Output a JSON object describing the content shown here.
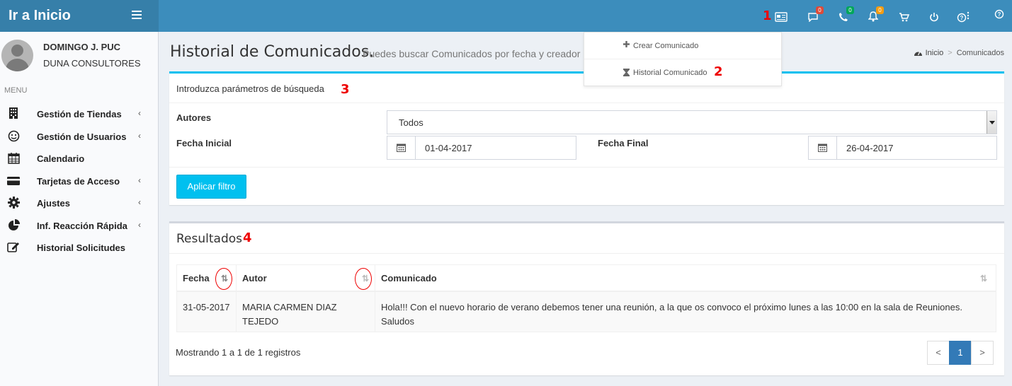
{
  "header": {
    "brand": "Ir a Inicio",
    "icons": [
      {
        "name": "newspaper-icon",
        "badge": ""
      },
      {
        "name": "chat-icon",
        "badge": "0",
        "badge_color": "#dd4b39"
      },
      {
        "name": "phone-icon",
        "badge": "0",
        "badge_color": "#00a65a"
      },
      {
        "name": "bell-icon",
        "badge": "0",
        "badge_color": "#f39c12"
      },
      {
        "name": "cart-icon",
        "badge": ""
      },
      {
        "name": "power-icon",
        "badge": ""
      },
      {
        "name": "help-icon",
        "badge": ""
      },
      {
        "name": "help-icon",
        "badge": ""
      }
    ]
  },
  "annotations": {
    "m1": "1",
    "m2": "2",
    "m3": "3",
    "m4": "4"
  },
  "dropdown": {
    "items": [
      {
        "icon": "plus-icon",
        "label": "Crear Comunicado"
      },
      {
        "icon": "hourglass-icon",
        "label": "Historial Comunicado"
      }
    ]
  },
  "sidebar": {
    "user_name": "DOMINGO J. PUC",
    "company": "DUNA CONSULTORES",
    "menu_header": "MENU",
    "items": [
      {
        "icon": "building-icon",
        "label": "Gestión de Tiendas",
        "chevron": true
      },
      {
        "icon": "smiley-icon",
        "label": "Gestión de Usuarios",
        "chevron": true
      },
      {
        "icon": "calendar-icon",
        "label": "Calendario",
        "chevron": false
      },
      {
        "icon": "credit-card-icon",
        "label": "Tarjetas de Acceso",
        "chevron": true
      },
      {
        "icon": "gear-icon",
        "label": "Ajustes",
        "chevron": true
      },
      {
        "icon": "pie-chart-icon",
        "label": "Inf. Reacción Rápida",
        "chevron": true
      },
      {
        "icon": "edit-icon",
        "label": "Historial Solicitudes",
        "chevron": false
      }
    ]
  },
  "page": {
    "title": "Historial de Comunicados.",
    "subtitle": "Puedes buscar Comunicados por fecha y creador",
    "breadcrumb": {
      "home": "Inicio",
      "current": "Comunicados"
    }
  },
  "filters": {
    "box_title": "Introduzca parámetros de búsqueda",
    "authors_label": "Autores",
    "authors_value": "Todos",
    "start_label": "Fecha Inicial",
    "start_value": "01-04-2017",
    "end_label": "Fecha Final",
    "end_value": "26-04-2017",
    "apply_button": "Aplicar filtro"
  },
  "results": {
    "box_title": "Resultados",
    "columns": [
      "Fecha",
      "Autor",
      "Comunicado"
    ],
    "rows": [
      {
        "fecha": "31-05-2017",
        "autor": "MARIA CARMEN DIAZ TEJEDO",
        "comunicado": "Hola!!! Con el nuevo horario de verano debemos tener una reunión, a la que os convoco el próximo lunes a las 10:00 en la sala de Reuniones. Saludos"
      }
    ],
    "showing": "Mostrando 1 a 1 de 1 registros",
    "pagination": {
      "prev": "<",
      "current": "1",
      "next": ">"
    }
  }
}
